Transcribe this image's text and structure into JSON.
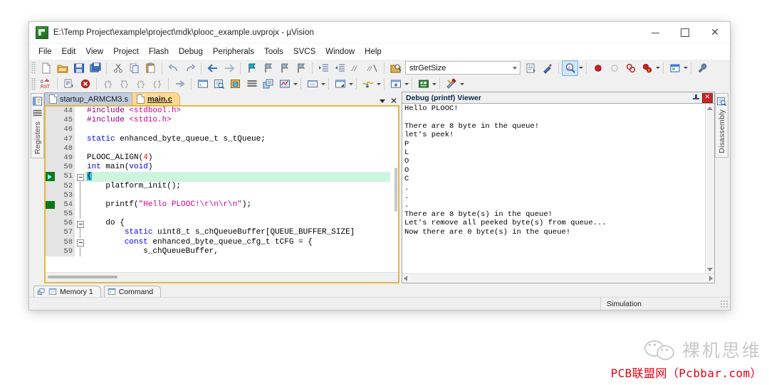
{
  "window": {
    "title": "E:\\Temp Project\\example\\project\\mdk\\plooc_example.uvprojx - µVision",
    "app_icon": "uvision-icon",
    "controls": {
      "minimize": "minimize-button",
      "maximize": "maximize-button",
      "close": "close-button"
    }
  },
  "menu": {
    "items": [
      "File",
      "Edit",
      "View",
      "Project",
      "Flash",
      "Debug",
      "Peripherals",
      "Tools",
      "SVCS",
      "Window",
      "Help"
    ]
  },
  "toolbar_main": {
    "buttons": [
      {
        "name": "new-file-icon"
      },
      {
        "name": "open-file-icon"
      },
      {
        "name": "save-icon"
      },
      {
        "name": "save-all-icon"
      },
      {
        "name": "cut-icon"
      },
      {
        "name": "copy-icon"
      },
      {
        "name": "paste-icon"
      },
      {
        "name": "undo-icon"
      },
      {
        "name": "redo-icon"
      },
      {
        "name": "navigate-back-icon"
      },
      {
        "name": "navigate-forward-icon"
      },
      {
        "name": "bookmark-toggle-icon"
      },
      {
        "name": "bookmark-prev-icon"
      },
      {
        "name": "bookmark-next-icon"
      },
      {
        "name": "bookmark-clear-icon"
      },
      {
        "name": "indent-icon"
      },
      {
        "name": "outdent-icon"
      },
      {
        "name": "comment-icon"
      },
      {
        "name": "uncomment-icon"
      },
      {
        "name": "find-in-files-icon"
      }
    ],
    "search_value": "strGetSize",
    "search_placeholder": "",
    "right_buttons": [
      {
        "name": "bookmark-list-icon"
      },
      {
        "name": "configure-icon"
      },
      {
        "name": "start-debug-icon",
        "active": true
      },
      {
        "name": "insert-breakpoint-icon"
      },
      {
        "name": "disable-breakpoint-icon"
      },
      {
        "name": "kill-all-breakpoints-icon"
      },
      {
        "name": "disable-all-breakpoints-icon"
      },
      {
        "name": "manage-windows-icon"
      },
      {
        "name": "configure-target-icon"
      }
    ]
  },
  "toolbar_debug": {
    "buttons": [
      {
        "name": "reset-cpu-icon"
      },
      {
        "name": "run-icon"
      },
      {
        "name": "stop-icon"
      },
      {
        "name": "step-into-icon"
      },
      {
        "name": "step-over-icon"
      },
      {
        "name": "step-out-icon"
      },
      {
        "name": "run-to-cursor-icon"
      },
      {
        "name": "show-next-statement-icon"
      },
      {
        "name": "command-window-icon"
      },
      {
        "name": "disassembly-window-icon"
      },
      {
        "name": "symbols-window-icon"
      },
      {
        "name": "registers-window-icon"
      },
      {
        "name": "call-stack-icon"
      },
      {
        "name": "watch-window-icon"
      },
      {
        "name": "memory-window-icon"
      },
      {
        "name": "serial-window-icon"
      },
      {
        "name": "analysis-window-icon"
      },
      {
        "name": "trace-window-icon"
      },
      {
        "name": "system-viewer-icon"
      },
      {
        "name": "toolbox-icon"
      }
    ]
  },
  "left_sidebar": {
    "items": [
      {
        "label": "",
        "icon": "project-window-icon"
      },
      {
        "label": "Registers",
        "icon": "registers-icon"
      }
    ]
  },
  "right_sidebar": {
    "items": [
      {
        "label": "Disassembly",
        "icon": "disassembly-icon"
      }
    ]
  },
  "editor": {
    "tabs": [
      {
        "label": "startup_ARMCM3.s",
        "active": false
      },
      {
        "label": "main.c",
        "active": true
      }
    ],
    "controls": {
      "dropdown": "tab-list-dropdown",
      "close": "close-document-button"
    },
    "lines": [
      {
        "n": "44",
        "marker": "",
        "fold": "",
        "html": "<span class='pp'>#include</span> <span class='str'>&lt;stdbool.h&gt;</span>",
        "current": false
      },
      {
        "n": "45",
        "marker": "",
        "fold": "",
        "html": "<span class='pp'>#include</span> <span class='str'>&lt;stdio.h&gt;</span>",
        "current": false
      },
      {
        "n": "46",
        "marker": "",
        "fold": "",
        "html": "",
        "current": false
      },
      {
        "n": "47",
        "marker": "",
        "fold": "",
        "html": "<span class='kw'>static</span> enhanced_byte_queue_t s_tQueue;",
        "current": false
      },
      {
        "n": "48",
        "marker": "",
        "fold": "",
        "html": "",
        "current": false
      },
      {
        "n": "49",
        "marker": "",
        "fold": "",
        "html": "PLOOC_ALIGN(<span class='num'>4</span>)",
        "current": false
      },
      {
        "n": "50",
        "marker": "",
        "fold": "",
        "html": "<span class='kw'>int</span> main(<span class='kw'>void</span>)",
        "current": false
      },
      {
        "n": "51",
        "marker": "pc-arrow",
        "fold": "collapse",
        "html": "<span class='selbox'>{</span>",
        "current": true
      },
      {
        "n": "52",
        "marker": "",
        "fold": "line",
        "html": "    platform_init();",
        "current": false
      },
      {
        "n": "53",
        "marker": "",
        "fold": "line",
        "html": "",
        "current": false
      },
      {
        "n": "54",
        "marker": "bp-block",
        "fold": "line",
        "html": "    printf(<span class='str'>\"Hello PLOOC!\\r\\n\\r\\n\"</span>);",
        "current": false
      },
      {
        "n": "55",
        "marker": "",
        "fold": "line",
        "html": "",
        "current": false
      },
      {
        "n": "56",
        "marker": "",
        "fold": "collapse",
        "html": "    do {",
        "current": false
      },
      {
        "n": "57",
        "marker": "",
        "fold": "line",
        "html": "        <span class='kw'>static</span> uint8_t s_chQueueBuffer[QUEUE_BUFFER_SIZE]",
        "current": false
      },
      {
        "n": "58",
        "marker": "",
        "fold": "collapse",
        "html": "        <span class='kw'>const</span> enhanced_byte_queue_cfg_t tCFG = {",
        "current": false
      },
      {
        "n": "59",
        "marker": "",
        "fold": "line",
        "html": "            s_chQueueBuffer,",
        "current": false
      }
    ]
  },
  "debug_viewer": {
    "title": "Debug (printf) Viewer",
    "pin_icon": "pin-icon",
    "close_icon": "close-panel-icon",
    "output": "Hello PLOOC!\n\nThere are 8 byte in the queue!\nlet's peek!\nP\nL\nO\nO\nC\n.\n.\n.\nThere are 8 byte(s) in the queue!\nLet's remove all peeked byte(s) from queue...\nNow there are 0 byte(s) in the queue!"
  },
  "bottom_tabs": [
    {
      "label": "Memory 1",
      "icon": "memory-icon"
    },
    {
      "label": "Command",
      "icon": "command-icon"
    }
  ],
  "status_bar": {
    "simulation": "Simulation"
  },
  "watermark": {
    "chinese": "裸机思维",
    "red_text": "PCB联盟网（Pcbbar.com）",
    "wechat_icon": "wechat-icon"
  },
  "colors": {
    "accent_tab": "#ffd893",
    "editor_border": "#e3b748",
    "current_line": "#ccf4df",
    "marker_green": "#0a7a14",
    "watermark_red": "#e60012"
  }
}
